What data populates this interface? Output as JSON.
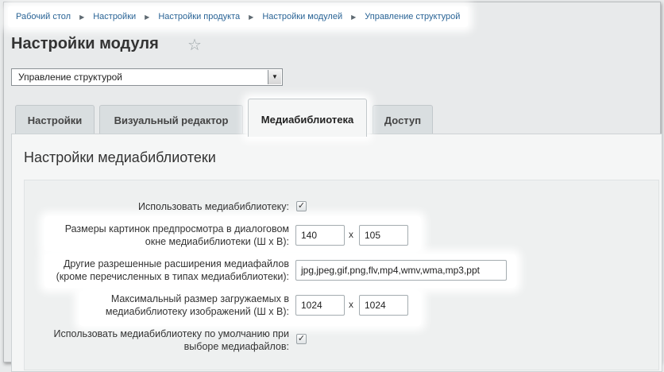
{
  "breadcrumb": [
    "Рабочий стол",
    "Настройки",
    "Настройки продукта",
    "Настройки модулей",
    "Управление структурой"
  ],
  "page_title": "Настройки модуля",
  "module_select": "Управление структурой",
  "tabs": [
    {
      "label": "Настройки",
      "active": false
    },
    {
      "label": "Визуальный редактор",
      "active": false
    },
    {
      "label": "Медиабиблиотека",
      "active": true
    },
    {
      "label": "Доступ",
      "active": false
    }
  ],
  "section_title": "Настройки медиабиблиотеки",
  "settings": {
    "use_medialib": {
      "label": "Использовать медиабиблиотеку:",
      "checked": true
    },
    "thumb_size": {
      "label_line1": "Размеры картинок предпросмотра в диалоговом",
      "label_line2": "окне медиабиблиотеки (Ш x В):",
      "width": "140",
      "height": "105"
    },
    "extensions": {
      "label_line1": "Другие разрешенные расширения медиафайлов",
      "label_line2": "(кроме перечисленных в типах медиабиблиотеки):",
      "value": "jpg,jpeg,gif,png,flv,mp4,wmv,wma,mp3,ppt"
    },
    "max_size": {
      "label_line1": "Максимальный размер загружаемых в",
      "label_line2": "медиабиблиотеку изображений (Ш x В):",
      "width": "1024",
      "height": "1024"
    },
    "default_medialib": {
      "label_line1": "Использовать медиабиблиотеку по умолчанию при",
      "label_line2": "выборе медиафайлов:",
      "checked": true
    }
  },
  "size_separator": "x",
  "icons": {
    "star": "star-icon",
    "dropdown": "chevron-down-icon",
    "separator": "chevron-right-icon",
    "check": "check-icon"
  }
}
